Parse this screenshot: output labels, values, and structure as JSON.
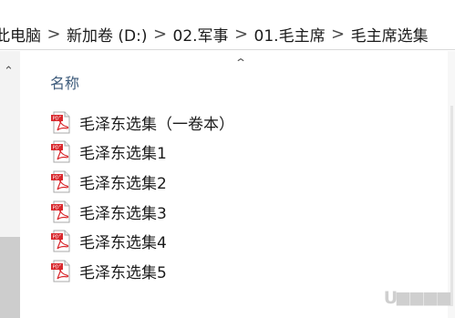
{
  "breadcrumb": [
    {
      "label": "此电脑"
    },
    {
      "label": "新加卷 (D:)"
    },
    {
      "label": "02.军事"
    },
    {
      "label": "01.毛主席"
    },
    {
      "label": "毛主席选集"
    }
  ],
  "breadcrumb_separator": ">",
  "column_header": "名称",
  "sort_indicator_icon": "chevron-up-icon",
  "files": [
    {
      "name": "毛泽东选集（一卷本）",
      "icon": "pdf-file-icon"
    },
    {
      "name": "毛泽东选集1",
      "icon": "pdf-file-icon"
    },
    {
      "name": "毛泽东选集2",
      "icon": "pdf-file-icon"
    },
    {
      "name": "毛泽东选集3",
      "icon": "pdf-file-icon"
    },
    {
      "name": "毛泽东选集4",
      "icon": "pdf-file-icon"
    },
    {
      "name": "毛泽东选集5",
      "icon": "pdf-file-icon"
    }
  ],
  "colors": {
    "pdf_red": "#d9282d",
    "header_text": "#3c5a7a"
  }
}
